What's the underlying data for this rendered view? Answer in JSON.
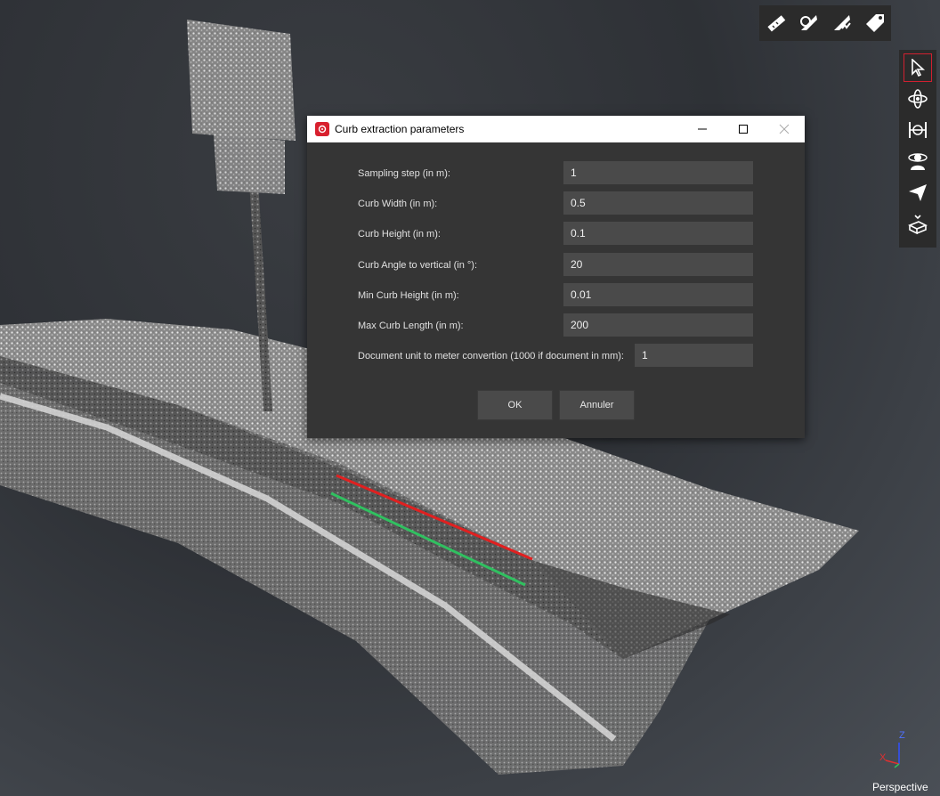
{
  "dialog": {
    "title": "Curb extraction parameters",
    "fields": [
      {
        "label": "Sampling step (in m):",
        "value": "1"
      },
      {
        "label": "Curb Width (in m):",
        "value": "0.5"
      },
      {
        "label": "Curb Height (in m):",
        "value": "0.1"
      },
      {
        "label": "Curb Angle to vertical (in °):",
        "value": "20"
      },
      {
        "label": "Min Curb Height (in m):",
        "value": "0.01"
      },
      {
        "label": "Max Curb Length (in m):",
        "value": "200"
      },
      {
        "label": "Document unit to meter convertion (1000 if document in mm):",
        "value": "1"
      }
    ],
    "ok_label": "OK",
    "cancel_label": "Annuler"
  },
  "top_toolbar": {
    "icons": [
      "ruler-icon",
      "measure-angle-icon",
      "measure-profile-icon",
      "tag-icon"
    ]
  },
  "side_toolbar": {
    "icons": [
      "select-pointer-icon",
      "orbit-icon",
      "pan-icon",
      "walk-icon",
      "navigate-icon",
      "eraser-icon"
    ],
    "active": "select-pointer-icon"
  },
  "axes": {
    "z": "Z",
    "x": "X"
  },
  "view_mode": "Perspective",
  "colors": {
    "accent": "#d8202e",
    "curb_top": "#e02020",
    "curb_bottom": "#30c060"
  }
}
